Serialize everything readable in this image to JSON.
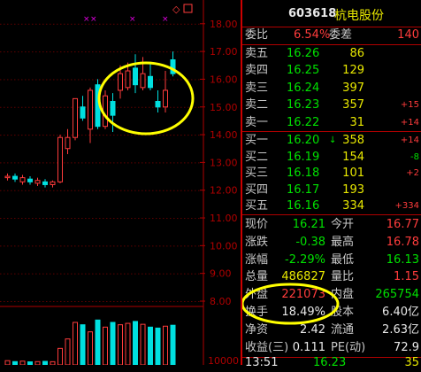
{
  "stock": {
    "code": "603618",
    "name": "杭电股份"
  },
  "header_icon": "diamond-icon",
  "commission": {
    "ratio_label": "委比",
    "ratio": "6.54%",
    "diff_label": "委差",
    "diff": "140"
  },
  "asks": [
    {
      "label": "卖五",
      "price": "16.26",
      "volume": "86",
      "change": ""
    },
    {
      "label": "卖四",
      "price": "16.25",
      "volume": "129",
      "change": ""
    },
    {
      "label": "卖三",
      "price": "16.24",
      "volume": "397",
      "change": ""
    },
    {
      "label": "卖二",
      "price": "16.23",
      "volume": "357",
      "change": "+15"
    },
    {
      "label": "卖一",
      "price": "16.22",
      "volume": "31",
      "change": "+14"
    }
  ],
  "bids": [
    {
      "label": "买一",
      "price": "16.20",
      "volume": "358",
      "change": "+14",
      "arrow": "↓"
    },
    {
      "label": "买二",
      "price": "16.19",
      "volume": "154",
      "change": "-8",
      "arrow": ""
    },
    {
      "label": "买三",
      "price": "16.18",
      "volume": "101",
      "change": "+2",
      "arrow": ""
    },
    {
      "label": "买四",
      "price": "16.17",
      "volume": "193",
      "change": "",
      "arrow": ""
    },
    {
      "label": "买五",
      "price": "16.16",
      "volume": "334",
      "change": "+334",
      "arrow": ""
    }
  ],
  "stats": [
    {
      "l1": "现价",
      "v1": "16.21",
      "l2": "今开",
      "v2": "16.77"
    },
    {
      "l1": "涨跌",
      "v1": "-0.38",
      "l2": "最高",
      "v2": "16.78"
    },
    {
      "l1": "涨幅",
      "v1": "-2.29%",
      "l2": "最低",
      "v2": "16.13"
    },
    {
      "l1": "总量",
      "v1": "486827",
      "l2": "量比",
      "v2": "1.15"
    },
    {
      "l1": "外盘",
      "v1": "221073",
      "l2": "内盘",
      "v2": "265754"
    },
    {
      "l1": "换手",
      "v1": "18.49%",
      "l2": "股本",
      "v2": "6.40亿"
    },
    {
      "l1": "净资",
      "v1": "2.42",
      "l2": "流通",
      "v2": "2.63亿"
    },
    {
      "l1": "收益(三)",
      "v1": "0.111",
      "l2": "PE(动)",
      "v2": "72.9"
    }
  ],
  "last_trade": {
    "time": "13:51",
    "price": "16.23",
    "volume": "35"
  },
  "price_axis": [
    "18.00",
    "17.00",
    "16.00",
    "15.00",
    "14.00",
    "13.00",
    "12.00",
    "11.00",
    "10.00",
    "9.00",
    "8.00"
  ],
  "volume_axis": [
    "10000"
  ],
  "colors": {
    "up": "#ff3c3c",
    "down": "#00e0e0",
    "highlight": "#ffff00",
    "grid": "#b00000"
  },
  "chart_data": {
    "type": "candlestick",
    "candles": [
      {
        "o": 12.45,
        "c": 12.5,
        "h": 12.6,
        "l": 12.35
      },
      {
        "o": 12.5,
        "c": 12.4,
        "h": 12.6,
        "l": 12.3
      },
      {
        "o": 12.3,
        "c": 12.45,
        "h": 12.55,
        "l": 12.2
      },
      {
        "o": 12.4,
        "c": 12.3,
        "h": 12.5,
        "l": 12.2
      },
      {
        "o": 12.25,
        "c": 12.35,
        "h": 12.45,
        "l": 12.15
      },
      {
        "o": 12.3,
        "c": 12.2,
        "h": 12.4,
        "l": 12.1
      },
      {
        "o": 12.2,
        "c": 12.3,
        "h": 12.35,
        "l": 12.1
      },
      {
        "o": 12.3,
        "c": 13.9,
        "h": 14.0,
        "l": 12.25
      },
      {
        "o": 13.5,
        "c": 13.9,
        "h": 14.2,
        "l": 13.3
      },
      {
        "o": 13.9,
        "c": 15.3,
        "h": 15.3,
        "l": 13.8
      },
      {
        "o": 15.0,
        "c": 14.6,
        "h": 15.4,
        "l": 14.5
      },
      {
        "o": 14.2,
        "c": 15.6,
        "h": 15.7,
        "l": 13.7
      },
      {
        "o": 15.8,
        "c": 14.3,
        "h": 16.0,
        "l": 14.2
      },
      {
        "o": 14.3,
        "c": 15.4,
        "h": 15.6,
        "l": 14.2
      },
      {
        "o": 15.2,
        "c": 14.7,
        "h": 15.5,
        "l": 14.1
      },
      {
        "o": 15.6,
        "c": 16.2,
        "h": 16.5,
        "l": 15.3
      },
      {
        "o": 15.7,
        "c": 16.3,
        "h": 16.6,
        "l": 15.6
      },
      {
        "o": 16.4,
        "c": 15.8,
        "h": 16.9,
        "l": 15.5
      },
      {
        "o": 15.7,
        "c": 16.2,
        "h": 16.8,
        "l": 15.6
      },
      {
        "o": 16.1,
        "c": 15.7,
        "h": 16.6,
        "l": 15.6
      },
      {
        "o": 15.2,
        "c": 15.0,
        "h": 15.6,
        "l": 14.8
      },
      {
        "o": 15.0,
        "c": 15.6,
        "h": 16.3,
        "l": 14.8
      },
      {
        "o": 16.7,
        "c": 16.2,
        "h": 17.0,
        "l": 16.1
      }
    ],
    "volumes": [
      900,
      700,
      800,
      650,
      700,
      750,
      680,
      3500,
      5500,
      9000,
      8500,
      7000,
      9500,
      8000,
      9000,
      8500,
      8800,
      9200,
      8600,
      8000,
      7800,
      8200,
      8400
    ],
    "ylim": [
      8,
      18.6
    ],
    "xlabel": "",
    "ylabel": ""
  }
}
